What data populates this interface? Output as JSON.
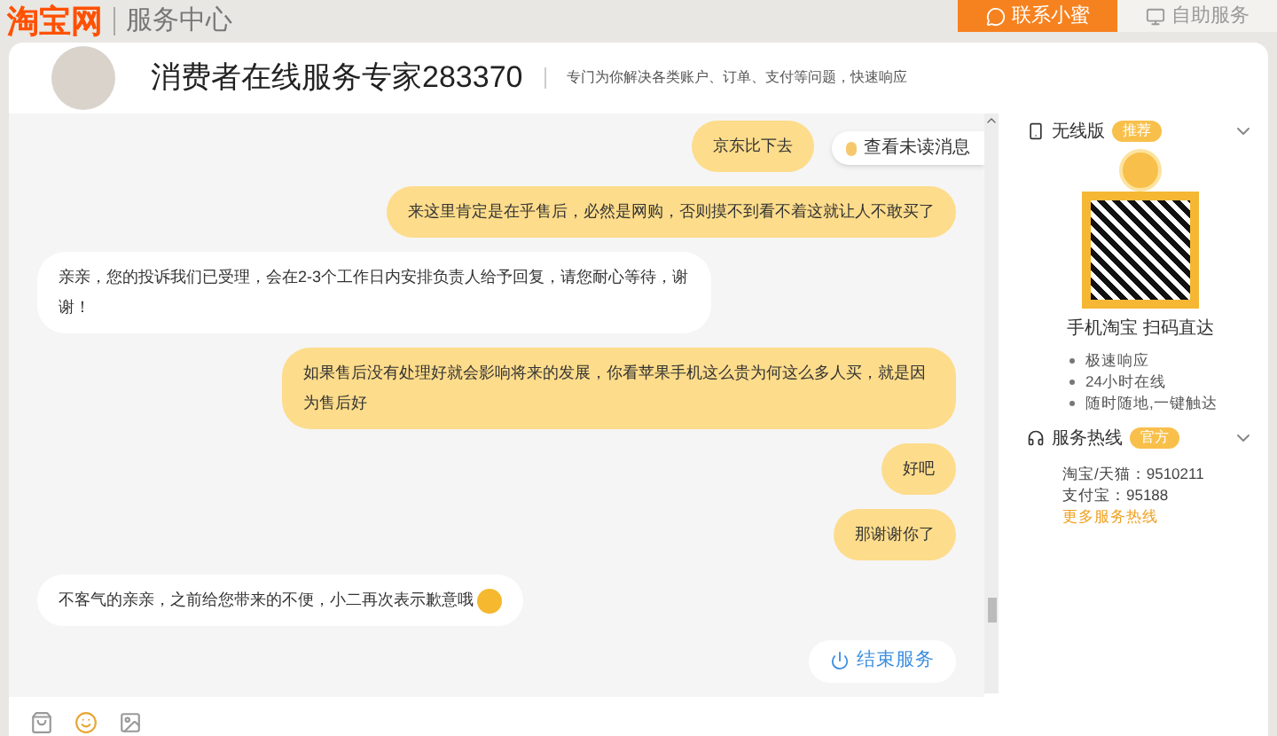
{
  "site": {
    "logo": "淘宝网",
    "section": "服务中心"
  },
  "top_buttons": [
    {
      "label": "联系小蜜",
      "selected": true
    },
    {
      "label": "自助服务",
      "selected": false
    }
  ],
  "agent": {
    "name": "消费者在线服务专家283370",
    "tagline": "专门为你解决各类账户、订单、支付等问题，快速响应"
  },
  "messages": [
    {
      "kind": "user",
      "text": "京东比下去"
    },
    {
      "kind": "user",
      "text": "来这里肯定是在乎售后，必然是网购，否则摸不到看不着这就让人不敢买了"
    },
    {
      "kind": "agent",
      "text": "亲亲，您的投诉我们已受理，会在2-3个工作日内安排负责人给予回复，请您耐心等待，谢谢！"
    },
    {
      "kind": "user",
      "text": "如果售后没有处理好就会影响将来的发展，你看苹果手机这么贵为何这么多人买，就是因为售后好"
    },
    {
      "kind": "user",
      "text": "好吧"
    },
    {
      "kind": "user",
      "text": "那谢谢你了"
    },
    {
      "kind": "agent",
      "text": "不客气的亲亲，之前给您带来的不便，小二再次表示歉意哦",
      "emoji": true
    }
  ],
  "unread_button": "查看未读消息",
  "end_button": "结束服务",
  "sidebar": {
    "mobile": {
      "title": "无线版",
      "badge": "推荐",
      "expanded": true,
      "caption": "手机淘宝 扫码直达",
      "features": [
        "极速响应",
        "24小时在线",
        "随时随地,一键触达"
      ]
    },
    "hotline": {
      "title": "服务热线",
      "badge": "官方",
      "expanded": true,
      "lines": [
        "淘宝/天猫：9510211",
        "支付宝：95188"
      ],
      "more_link": "更多服务热线"
    }
  }
}
